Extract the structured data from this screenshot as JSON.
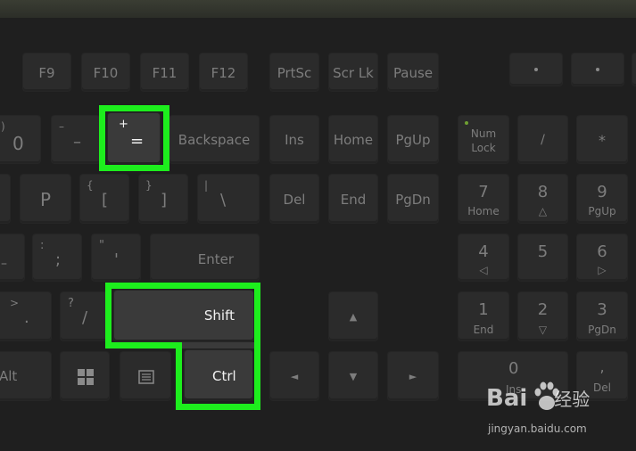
{
  "colors": {
    "highlight": "#1dee1d",
    "key_face": "#2b2b2b",
    "key_text": "#7d7d7d",
    "key_text_highlighted": "#f2f2f2"
  },
  "keys": {
    "f9": "F9",
    "f10": "F10",
    "f11": "F11",
    "f12": "F12",
    "prtsc": "PrtSc",
    "scrlk": "Scr Lk",
    "pause": "Pause",
    "paren_top": ")",
    "zero": "0",
    "underscore_top": "–",
    "minus": "–",
    "plus_top": "+",
    "equals": "=",
    "backspace": "Backspace",
    "ins": "Ins",
    "home": "Home",
    "pgup": "PgUp",
    "numlock_line1": "Num",
    "numlock_line2": "Lock",
    "num_slash": "/",
    "num_star": "*",
    "p": "P",
    "brace_open_top": "{",
    "bracket_open": "[",
    "brace_close_top": "}",
    "bracket_close": "]",
    "pipe_top": "|",
    "backslash": "\\",
    "del": "Del",
    "end": "End",
    "pgdn": "PgDn",
    "num7": "7",
    "num7_sub": "Home",
    "num8": "8",
    "num8_sub": "△",
    "num9": "9",
    "num9_sub": "PgUp",
    "colon_top": ":",
    "semicolon": ";",
    "quote_top": "\"",
    "quote": "'",
    "enter": "Enter",
    "num4": "4",
    "num4_sub": "◁",
    "num5": "5",
    "num6": "6",
    "num6_sub": "▷",
    "gt_top": ">",
    "period": ".",
    "question_top": "?",
    "slash": "/",
    "shift": "Shift",
    "arrow_up": "▲",
    "num1": "1",
    "num1_sub": "End",
    "num2": "2",
    "num2_sub": "▽",
    "num3": "3",
    "num3_sub": "PgDn",
    "alt": "Alt",
    "ctrl": "Ctrl",
    "arrow_left": "◄",
    "arrow_down": "▼",
    "arrow_right": "►",
    "num0": "0",
    "num0_sub": "Ins",
    "numdot_top": ",",
    "numdot_sub": "Del"
  },
  "watermark": {
    "brand": "Bai",
    "brand_suffix": "经验",
    "url": "jingyan.baidu.com"
  }
}
